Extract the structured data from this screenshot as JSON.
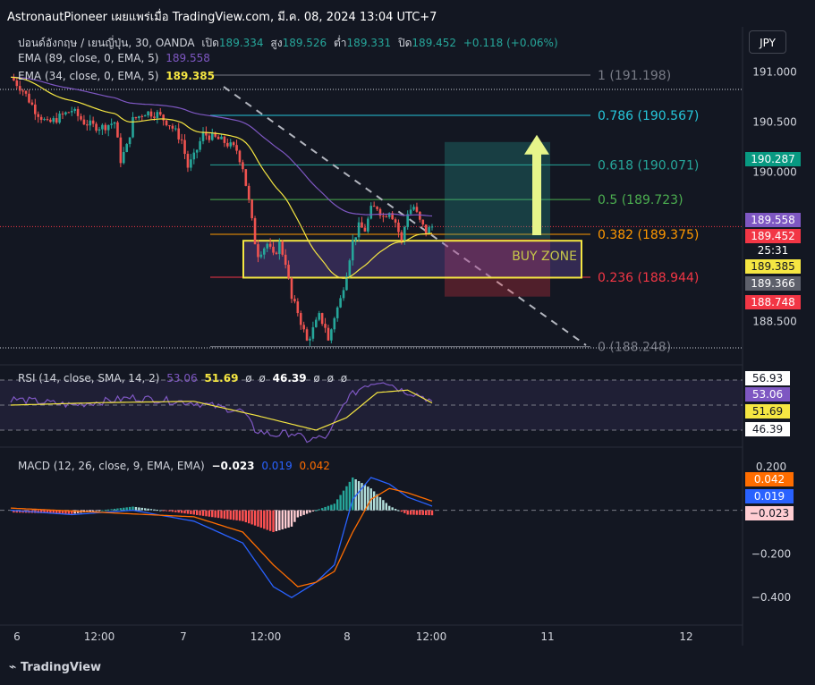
{
  "header": {
    "title": "AstronautPioneer เผยแพร่เมื่อ TradingView.com, มี.ค. 08, 2024 13:04 UTC+7"
  },
  "legend": {
    "symbol": "ปอนด์อังกฤษ / เยนญี่ปุ่น, 30, OANDA",
    "open_label": "เปิด",
    "open": "189.334",
    "high_label": "สูง",
    "high": "189.526",
    "low_label": "ต่ำ",
    "low": "189.331",
    "close_label": "ปิด",
    "close": "189.452",
    "change": "+0.118 (+0.06%)",
    "ema89_label": "EMA (89, close, 0, EMA, 5)",
    "ema89_value": "189.558",
    "ema34_label": "EMA (34, close, 0, EMA, 5)",
    "ema34_value": "189.385"
  },
  "currency_button": "JPY",
  "rsi_legend": {
    "label": "RSI (14, close, SMA, 14, 2)",
    "v1": "53.06",
    "v2": "51.69",
    "v3": "ø",
    "v4": "ø",
    "v5": "46.39",
    "v6": "ø",
    "v7": "ø",
    "v8": "ø"
  },
  "macd_legend": {
    "label": "MACD (12, 26, close, 9, EMA, EMA)",
    "hist": "−0.023",
    "macd": "0.019",
    "signal": "0.042"
  },
  "footer": {
    "brand": "TradingView"
  },
  "colors": {
    "background": "#131722",
    "up": "#26a69a",
    "down": "#ef5350",
    "ema89": "#7e57c2",
    "ema34": "#f5e642",
    "macd": "#2962ff",
    "signal": "#ff6d00",
    "fib_0786": "#26c6da",
    "fib_0618": "#26a69a",
    "fib_05": "#4caf50",
    "fib_0382": "#ff9800",
    "fib_0236": "#f23645",
    "fib_gray": "#787b86",
    "arrow": "#e6f58a",
    "zone_border": "#f5e642"
  },
  "chart_data": [
    {
      "type": "candlestick",
      "title": "",
      "price_axis": {
        "range": [
          188.2,
          191.15
        ],
        "ticks": [
          191.0,
          190.5,
          190.0,
          188.5
        ],
        "tick_labels": [
          "191.000",
          "190.500",
          "190.000",
          "188.500"
        ]
      },
      "time_axis": {
        "tick_labels": [
          "6",
          "12:00",
          "7",
          "12:00",
          "8",
          "12:00",
          "11",
          "12"
        ]
      },
      "price_path": [
        [
          0,
          190.95
        ],
        [
          4,
          190.82
        ],
        [
          8,
          190.62
        ],
        [
          12,
          190.48
        ],
        [
          16,
          190.55
        ],
        [
          20,
          190.62
        ],
        [
          24,
          190.5
        ],
        [
          27,
          190.46
        ],
        [
          30,
          190.45
        ],
        [
          34,
          190.5
        ],
        [
          36,
          190.12
        ],
        [
          38,
          190.25
        ],
        [
          40,
          190.52
        ],
        [
          44,
          190.6
        ],
        [
          48,
          190.58
        ],
        [
          52,
          190.48
        ],
        [
          56,
          190.32
        ],
        [
          58,
          190.05
        ],
        [
          60,
          190.15
        ],
        [
          63,
          190.38
        ],
        [
          66,
          190.35
        ],
        [
          70,
          190.3
        ],
        [
          74,
          190.22
        ],
        [
          76,
          190.05
        ],
        [
          78,
          189.7
        ],
        [
          80,
          189.3
        ],
        [
          81,
          189.18
        ],
        [
          84,
          189.28
        ],
        [
          86,
          189.15
        ],
        [
          88,
          189.28
        ],
        [
          90,
          189.1
        ],
        [
          92,
          188.72
        ],
        [
          94,
          188.6
        ],
        [
          97,
          188.3
        ],
        [
          99,
          188.42
        ],
        [
          101,
          188.55
        ],
        [
          103,
          188.45
        ],
        [
          104,
          188.3
        ],
        [
          106,
          188.55
        ],
        [
          108,
          188.72
        ],
        [
          110,
          189.0
        ],
        [
          112,
          189.3
        ],
        [
          114,
          189.45
        ],
        [
          116,
          189.42
        ],
        [
          118,
          189.62
        ],
        [
          120,
          189.65
        ],
        [
          122,
          189.55
        ],
        [
          124,
          189.62
        ],
        [
          126,
          189.5
        ],
        [
          128,
          189.3
        ],
        [
          130,
          189.6
        ],
        [
          132,
          189.65
        ],
        [
          134,
          189.5
        ],
        [
          136,
          189.4
        ],
        [
          138,
          189.452
        ]
      ],
      "candle_count": 138,
      "current_price": 189.452,
      "countdown": "25:31",
      "price_labels": [
        {
          "value": 190.287,
          "label": "190.287",
          "color": "#089981"
        },
        {
          "value": 189.558,
          "label": "189.558",
          "color": "#7e57c2"
        },
        {
          "value": 189.452,
          "label": "189.452",
          "color": "#f23645"
        },
        {
          "value": 189.385,
          "label": "189.385",
          "color": "#f5e642"
        },
        {
          "value": 189.366,
          "label": "189.366",
          "color": "#5d606b"
        },
        {
          "value": 188.748,
          "label": "188.748",
          "color": "#f23645"
        }
      ],
      "fib_levels": [
        {
          "level": "1",
          "value": 191.198,
          "label": "1 (191.198)"
        },
        {
          "level": "0.786",
          "value": 190.567,
          "label": "0.786 (190.567)"
        },
        {
          "level": "0.618",
          "value": 190.071,
          "label": "0.618 (190.071)"
        },
        {
          "level": "0.5",
          "value": 189.723,
          "label": "0.5 (189.723)"
        },
        {
          "level": "0.382",
          "value": 189.375,
          "label": "0.382 (189.375)"
        },
        {
          "level": "0.236",
          "value": 188.944,
          "label": "0.236 (188.944)"
        },
        {
          "level": "0",
          "value": 188.248,
          "label": "0 (188.248)"
        }
      ],
      "zone": {
        "label": "BUY ZONE",
        "top": 189.31,
        "bottom": 188.94
      },
      "position": {
        "entry": 189.33,
        "target": 190.3,
        "stop": 188.75
      },
      "series": [
        {
          "name": "EMA (89, close, 0, EMA, 5)",
          "last": 189.558
        },
        {
          "name": "EMA (34, close, 0, EMA, 5)",
          "last": 189.385
        }
      ]
    },
    {
      "type": "line",
      "title": "RSI (14, close, SMA, 14, 2)",
      "y_labels": [
        "56.93",
        "53.06",
        "51.69",
        "46.39"
      ],
      "ylim": [
        0,
        100
      ],
      "series": [
        {
          "name": "RSI",
          "path": [
            [
              0,
              55
            ],
            [
              20,
              50
            ],
            [
              40,
              56
            ],
            [
              60,
              52
            ],
            [
              76,
              45
            ],
            [
              80,
              30
            ],
            [
              86,
              26
            ],
            [
              92,
              28
            ],
            [
              97,
              22
            ],
            [
              104,
              25
            ],
            [
              110,
              55
            ],
            [
              116,
              66
            ],
            [
              122,
              70
            ],
            [
              128,
              62
            ],
            [
              134,
              58
            ],
            [
              138,
              53.06
            ]
          ]
        },
        {
          "name": "RSI-based MA",
          "path": [
            [
              0,
              50
            ],
            [
              30,
              52
            ],
            [
              60,
              53
            ],
            [
              80,
              42
            ],
            [
              100,
              30
            ],
            [
              110,
              40
            ],
            [
              120,
              60
            ],
            [
              130,
              62
            ],
            [
              138,
              51.69
            ]
          ]
        }
      ]
    },
    {
      "type": "bar+line",
      "title": "MACD (12, 26, close, 9, EMA, EMA)",
      "y_ticks": [
        0.2,
        -0.2,
        -0.4
      ],
      "y_tick_labels": [
        "0.200",
        "−0.200",
        "−0.400"
      ],
      "ylim": [
        -0.44,
        0.24
      ],
      "series": [
        {
          "name": "MACD",
          "path": [
            [
              0,
              0.0
            ],
            [
              20,
              -0.02
            ],
            [
              40,
              0.0
            ],
            [
              60,
              -0.05
            ],
            [
              76,
              -0.15
            ],
            [
              86,
              -0.35
            ],
            [
              92,
              -0.4
            ],
            [
              100,
              -0.33
            ],
            [
              106,
              -0.25
            ],
            [
              112,
              0.05
            ],
            [
              118,
              0.15
            ],
            [
              124,
              0.12
            ],
            [
              130,
              0.06
            ],
            [
              138,
              0.019
            ]
          ]
        },
        {
          "name": "Signal",
          "path": [
            [
              0,
              0.01
            ],
            [
              30,
              -0.01
            ],
            [
              60,
              -0.03
            ],
            [
              76,
              -0.1
            ],
            [
              86,
              -0.25
            ],
            [
              94,
              -0.35
            ],
            [
              100,
              -0.33
            ],
            [
              106,
              -0.28
            ],
            [
              112,
              -0.1
            ],
            [
              118,
              0.05
            ],
            [
              124,
              0.1
            ],
            [
              130,
              0.08
            ],
            [
              138,
              0.042
            ]
          ]
        }
      ],
      "last_histogram": -0.023
    }
  ]
}
